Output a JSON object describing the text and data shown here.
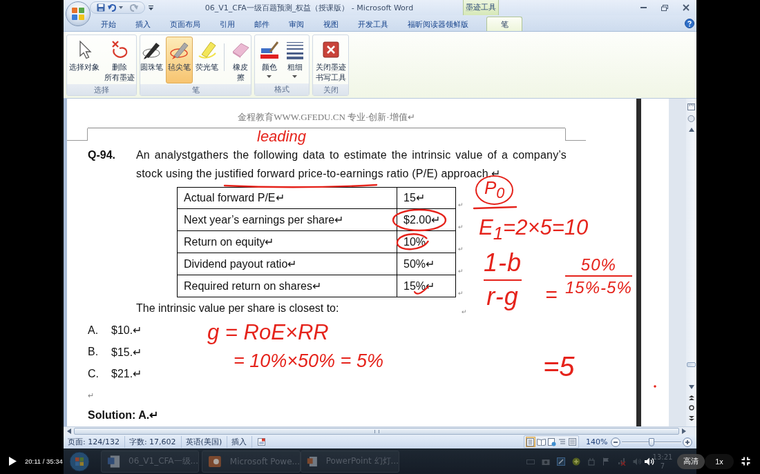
{
  "window": {
    "title": "06_V1_CFA一级百题预测_权益（授课版） - Microsoft Word"
  },
  "tabs": [
    {
      "label": "开始",
      "selected": false
    },
    {
      "label": "插入",
      "selected": false
    },
    {
      "label": "页面布局",
      "selected": false
    },
    {
      "label": "引用",
      "selected": false
    },
    {
      "label": "邮件",
      "selected": false
    },
    {
      "label": "审阅",
      "selected": false
    },
    {
      "label": "视图",
      "selected": false
    },
    {
      "label": "开发工具",
      "selected": false
    },
    {
      "label": "福昕阅读器领鲜版",
      "selected": false
    }
  ],
  "context_tabs": {
    "group": "墨迹工具",
    "tabs": [
      {
        "label": "笔",
        "selected": true
      }
    ]
  },
  "ribbon_groups": [
    {
      "label": "选择",
      "buttons": [
        {
          "lines": [
            "选择对象"
          ],
          "selected": false,
          "dropdown": false
        },
        {
          "lines": [
            "删除",
            "所有墨迹"
          ],
          "selected": false,
          "dropdown": false
        }
      ]
    },
    {
      "label": "笔",
      "buttons": [
        {
          "lines": [
            "圆珠笔"
          ],
          "selected": false,
          "dropdown": false
        },
        {
          "lines": [
            "毡尖笔"
          ],
          "selected": true,
          "dropdown": false
        },
        {
          "lines": [
            "荧光笔"
          ],
          "selected": false,
          "dropdown": false
        },
        {
          "lines": [
            "橡皮",
            "擦"
          ],
          "selected": false,
          "dropdown": false
        }
      ]
    },
    {
      "label": "格式",
      "buttons": [
        {
          "lines": [
            "颜色"
          ],
          "selected": false,
          "dropdown": true
        },
        {
          "lines": [
            "粗细"
          ],
          "selected": false,
          "dropdown": true
        }
      ]
    },
    {
      "label": "关闭",
      "buttons": [
        {
          "lines": [
            "关闭墨迹",
            "书写工具"
          ],
          "selected": false,
          "dropdown": false
        }
      ]
    }
  ],
  "document": {
    "header": "金程教育WWW.GFEDU.CN 专业·创新·增值↵",
    "question_number": "Q-94.",
    "question": "An analystgathers the following data to estimate the intrinsic value of a company’s stock using the justified forward price-to-earnings ratio (P/E) approach.↵",
    "table": {
      "rows": [
        {
          "label": "Actual forward P/E↵",
          "value": "15↵",
          "row_mark": "↵"
        },
        {
          "label": "Next year’s earnings per share↵",
          "value": "$2.00↵",
          "row_mark": "↵"
        },
        {
          "label": "Return on equity↵",
          "value": "10%",
          "row_mark": "↵"
        },
        {
          "label": "Dividend payout ratio↵",
          "value": "50%↵",
          "row_mark": "↵"
        },
        {
          "label": "Required return on shares↵",
          "value": "15%↵",
          "row_mark": "↵"
        }
      ]
    },
    "prompt": "The intrinsic value per share is closest to:",
    "after_table_mark": "↵",
    "options": [
      {
        "letter": "A.",
        "text": "$10.↵"
      },
      {
        "letter": "B.",
        "text": "$15.↵"
      },
      {
        "letter": "C.",
        "text": "$21.↵"
      }
    ],
    "empty_paragraph": "↵",
    "solution": "Solution: A.↵"
  },
  "ink_notes": [
    {
      "kind": "text",
      "text": "leading"
    },
    {
      "kind": "circled",
      "text": "P$_{0}$"
    },
    {
      "kind": "text",
      "text": "E$_{1}$=2×5=10"
    },
    {
      "kind": "fraction",
      "numerator": "1-b",
      "denominator": "r-g"
    },
    {
      "kind": "text",
      "text": "="
    },
    {
      "kind": "fraction",
      "numerator": "50%",
      "denominator": "15%-5%"
    },
    {
      "kind": "text",
      "text": "=5"
    },
    {
      "kind": "text",
      "text": "g = RoE×RR"
    },
    {
      "kind": "text",
      "text": "= 10%×50% = 5%"
    }
  ],
  "status_bar": {
    "page": "页面: 124/132",
    "words": "字数: 17,602",
    "language": "英语(美国)",
    "mode": "插入",
    "views": [
      {
        "selected": true
      },
      {
        "selected": false
      },
      {
        "selected": false
      },
      {
        "selected": false
      },
      {
        "selected": false
      }
    ],
    "zoom": "140%",
    "zoom_slider": {
      "level": 0.5
    }
  },
  "taskbar": {
    "buttons": [
      {
        "label": "06_V1_CFA一级..."
      },
      {
        "label": "Microsoft Powe..."
      },
      {
        "label": "PowerPoint 幻灯..."
      }
    ],
    "clock": [
      "13:21",
      "7"
    ]
  },
  "player": {
    "time": "20:11 / 35:34",
    "quality": "高清",
    "speed": "1x"
  }
}
